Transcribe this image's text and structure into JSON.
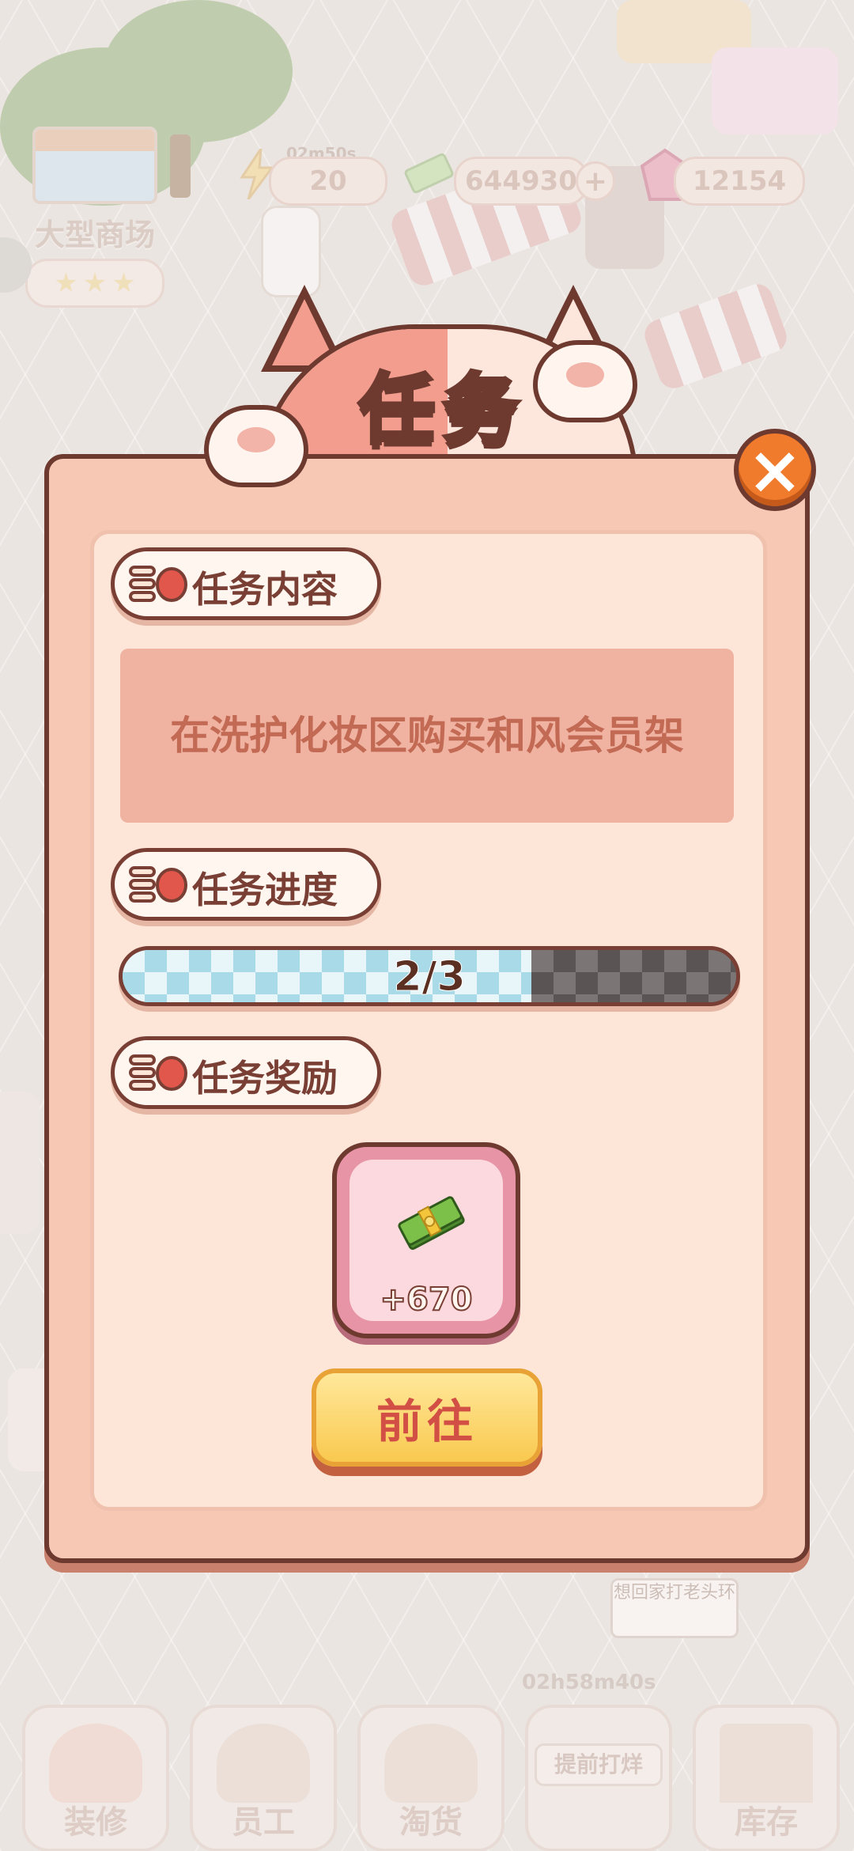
{
  "hud": {
    "energy_timer": "02m50s",
    "energy": "20",
    "cash": "644930",
    "gems": "12154"
  },
  "store": {
    "name": "大型商场",
    "stars": 3
  },
  "dialog": {
    "title": "任务",
    "close_icon": "close-icon",
    "sections": {
      "content_label": "任务内容",
      "progress_label": "任务进度",
      "reward_label": "任务奖励"
    },
    "task_text": "在洗护化妆区购买和风会员架",
    "progress": {
      "current": 2,
      "total": 3,
      "text": "2/3"
    },
    "reward": {
      "icon": "cash-stack-icon",
      "amount": "+670"
    },
    "go_button": "前往"
  },
  "world": {
    "npc_speech": "想回家打老头环",
    "rush_timer": "02h58m40s"
  },
  "bottom_nav": [
    {
      "label": "装修",
      "icon": "decorate-icon"
    },
    {
      "label": "员工",
      "icon": "staff-icon"
    },
    {
      "label": "淘货",
      "icon": "shopping-icon"
    },
    {
      "label": "提前打烊",
      "icon": "close-early-icon"
    },
    {
      "label": "库存",
      "icon": "warehouse-icon"
    }
  ],
  "colors": {
    "dialog_bg": "#f7c9b5",
    "outline": "#6e3a30",
    "title": "#f6b12c",
    "progress_fill": "#a8dbe7",
    "button": "#f9c94f",
    "button_text": "#d14f44"
  }
}
